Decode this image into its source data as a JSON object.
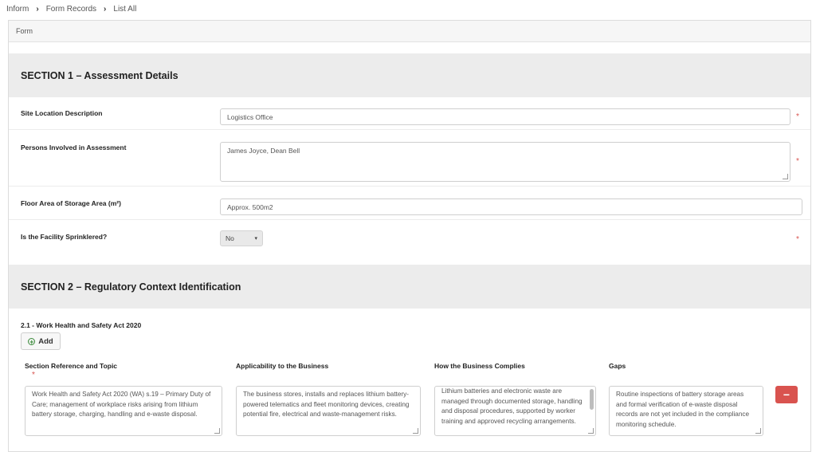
{
  "breadcrumb": [
    "Inform",
    "Form Records",
    "List All"
  ],
  "panel": {
    "title": "Form"
  },
  "section1": {
    "title": "SECTION 1 – Assessment Details",
    "fields": {
      "site_location": {
        "label": "Site Location Description",
        "value": "Logistics Office",
        "required": true
      },
      "persons_involved": {
        "label": "Persons Involved in Assessment",
        "value": "James Joyce, Dean Bell",
        "required": true
      },
      "floor_area": {
        "label": "Floor Area of Storage Area (m²)",
        "value": "Approx. 500m2",
        "required": false
      },
      "sprinklered": {
        "label": "Is the Facility Sprinklered?",
        "value": "No",
        "required": true
      }
    }
  },
  "section2": {
    "title": "SECTION 2 – Regulatory Context Identification",
    "subsection": "2.1 - Work Health and Safety Act 2020",
    "add_label": "Add",
    "columns": [
      "Section Reference and Topic",
      "Applicability to the Business",
      "How the Business Complies",
      "Gaps"
    ],
    "rows": [
      {
        "reference": "Work Health and Safety Act 2020 (WA) s.19 – Primary Duty of Care; management of workplace risks arising from lithium battery storage, charging, handling and e-waste disposal.",
        "applicability": "The business stores, installs and replaces lithium battery-powered telematics and fleet monitoring devices, creating potential fire, electrical and waste-management risks.",
        "compliance": "Lithium batteries and electronic waste are managed through documented storage, handling and disposal procedures, supported by worker training and approved recycling arrangements.",
        "gaps": "Routine inspections of battery storage areas and formal verification of e-waste disposal records are not yet included in the compliance monitoring schedule."
      }
    ],
    "remove_label": "−"
  },
  "icons": {
    "breadcrumb_separator": "chevron-right-icon",
    "select": "chevron-down-icon",
    "add": "plus-circle-icon",
    "remove": "minus-icon"
  },
  "colors": {
    "required": "#d9534f",
    "remove_button": "#d9534f",
    "add_icon": "#3a8a3a",
    "section_bg": "#ececec"
  }
}
